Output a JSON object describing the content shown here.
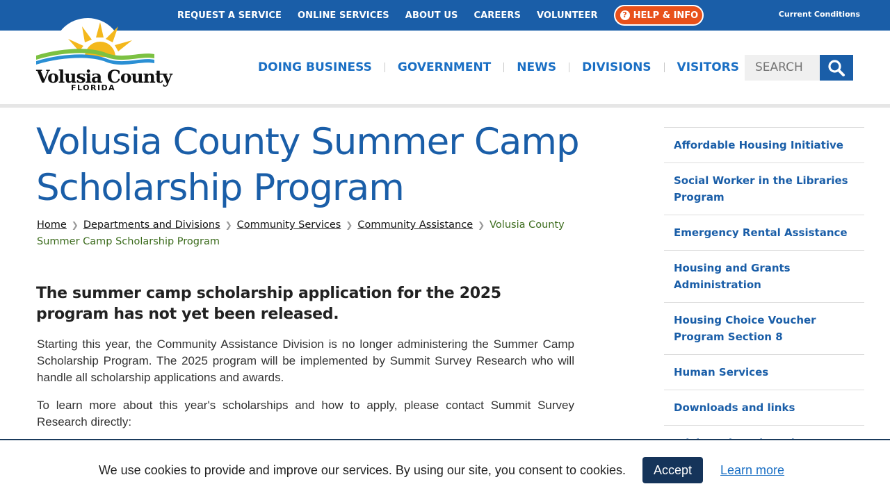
{
  "topbar": {
    "links": [
      "REQUEST A SERVICE",
      "ONLINE SERVICES",
      "ABOUT US",
      "CAREERS",
      "VOLUNTEER"
    ],
    "help_label": "HELP & INFO",
    "conditions_label": "Current Conditions"
  },
  "logo": {
    "name": "Volusia County",
    "sub": "FLORIDA"
  },
  "mainnav": {
    "items": [
      "DOING BUSINESS",
      "GOVERNMENT",
      "NEWS",
      "DIVISIONS",
      "VISITORS"
    ]
  },
  "search": {
    "placeholder": "SEARCH"
  },
  "page": {
    "title": "Volusia County Summer Camp Scholarship Program",
    "breadcrumb": [
      "Home",
      "Departments and Divisions",
      "Community Services",
      "Community Assistance"
    ],
    "breadcrumb_current": "Volusia County Summer Camp Scholarship Program",
    "notice": "The summer camp scholarship application for the 2025 program has not yet been released.",
    "para1": "Starting this year, the Community Assistance Division is no longer administering the Summer Camp Scholarship Program. The 2025 program will be implemented by Summit Survey Research who will handle all scholarship applications and awards.",
    "para2": "To learn more about this year's scholarships and how to apply, please contact Summit Survey Research directly:"
  },
  "sidebar": {
    "items": [
      "Affordable Housing Initiative",
      "Social Worker in the Libraries Program",
      "Emergency Rental Assistance",
      "Housing and Grants Administration",
      "Housing Choice Voucher Program Section 8",
      "Human Services",
      "Downloads and links",
      "Advisory boards and committees"
    ]
  },
  "cookie": {
    "text": "We use cookies to provide and improve our services. By using our site, you consent to cookies.",
    "accept_label": "Accept",
    "learn_more_label": "Learn more"
  },
  "colors": {
    "brand_blue": "#1a5ea8",
    "link_blue": "#1a6fc4",
    "help_orange": "#e8501a",
    "accept_navy": "#15345a",
    "breadcrumb_current_green": "#3b6b1c"
  }
}
